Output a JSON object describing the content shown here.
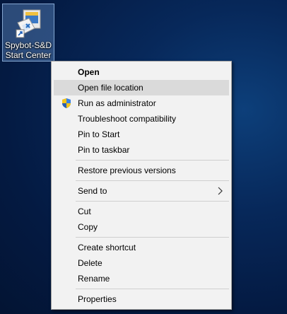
{
  "desktop_icon": {
    "label": "Spybot-S&D\nStart Center"
  },
  "menu": {
    "items": [
      {
        "label": "Open"
      },
      {
        "label": "Open file location"
      },
      {
        "label": "Run as administrator"
      },
      {
        "label": "Troubleshoot compatibility"
      },
      {
        "label": "Pin to Start"
      },
      {
        "label": "Pin to taskbar"
      },
      {
        "label": "Restore previous versions"
      },
      {
        "label": "Send to"
      },
      {
        "label": "Cut"
      },
      {
        "label": "Copy"
      },
      {
        "label": "Create shortcut"
      },
      {
        "label": "Delete"
      },
      {
        "label": "Rename"
      },
      {
        "label": "Properties"
      }
    ]
  },
  "icons": {
    "shield": "uac-shield-icon",
    "submenu_arrow": "chevron-right-icon",
    "shortcut_arrow": "shortcut-arrow-icon"
  },
  "colors": {
    "menu_bg": "#f2f2f2",
    "hover_bg": "#dadada",
    "desktop_bg": "#06214f"
  }
}
